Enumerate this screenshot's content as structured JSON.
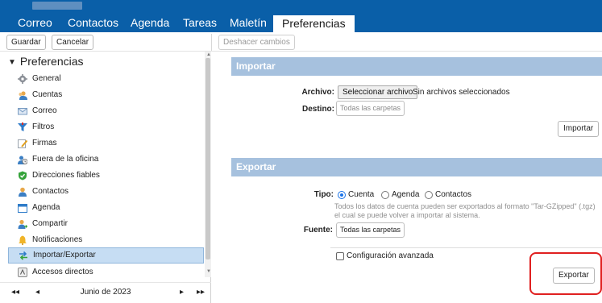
{
  "nav": {
    "tabs": [
      {
        "label": "Correo"
      },
      {
        "label": "Contactos"
      },
      {
        "label": "Agenda"
      },
      {
        "label": "Tareas"
      },
      {
        "label": "Maletín"
      },
      {
        "label": "Preferencias",
        "active": true
      }
    ]
  },
  "toolbar": {
    "save_label": "Guardar",
    "cancel_label": "Cancelar",
    "undo_label": "Deshacer cambios"
  },
  "sidebar": {
    "title": "Preferencias",
    "items": [
      {
        "label": "General",
        "icon": "gear-icon"
      },
      {
        "label": "Cuentas",
        "icon": "accounts-icon"
      },
      {
        "label": "Correo",
        "icon": "mail-icon"
      },
      {
        "label": "Filtros",
        "icon": "filter-icon"
      },
      {
        "label": "Firmas",
        "icon": "signature-icon"
      },
      {
        "label": "Fuera de la oficina",
        "icon": "out-of-office-icon"
      },
      {
        "label": "Direcciones fiables",
        "icon": "shield-icon"
      },
      {
        "label": "Contactos",
        "icon": "contacts-icon"
      },
      {
        "label": "Agenda",
        "icon": "calendar-icon"
      },
      {
        "label": "Compartir",
        "icon": "share-icon"
      },
      {
        "label": "Notificaciones",
        "icon": "bell-icon"
      },
      {
        "label": "Importar/Exportar",
        "icon": "import-export-icon",
        "selected": true
      },
      {
        "label": "Accesos directos",
        "icon": "shortcuts-icon"
      }
    ]
  },
  "calendar": {
    "month_label": "Junio de 2023",
    "prev_year": "◂◂",
    "prev_month": "◂",
    "next_month": "▸",
    "next_year": "▸▸"
  },
  "import": {
    "section_title": "Importar",
    "file_label": "Archivo:",
    "file_button": "Seleccionar archivo",
    "file_status": "Sin archivos seleccionados",
    "dest_label": "Destino:",
    "dest_value": "Todas las carpetas",
    "action_label": "Importar"
  },
  "export": {
    "section_title": "Exportar",
    "type_label": "Tipo:",
    "type_options": [
      "Cuenta",
      "Agenda",
      "Contactos"
    ],
    "type_selected": "Cuenta",
    "note": "Todos los datos de cuenta pueden ser exportados al formato \"Tar-GZipped\" (.tgz) el cual se puede volver a importar al sistema.",
    "source_label": "Fuente:",
    "source_value": "Todas las carpetas",
    "advanced_label": "Configuración avanzada",
    "action_label": "Exportar"
  },
  "colors": {
    "header_blue": "#0a5fa8",
    "section_header": "#a6c1de",
    "selected_row": "#c6ddf3",
    "highlight_red": "#e02020"
  }
}
